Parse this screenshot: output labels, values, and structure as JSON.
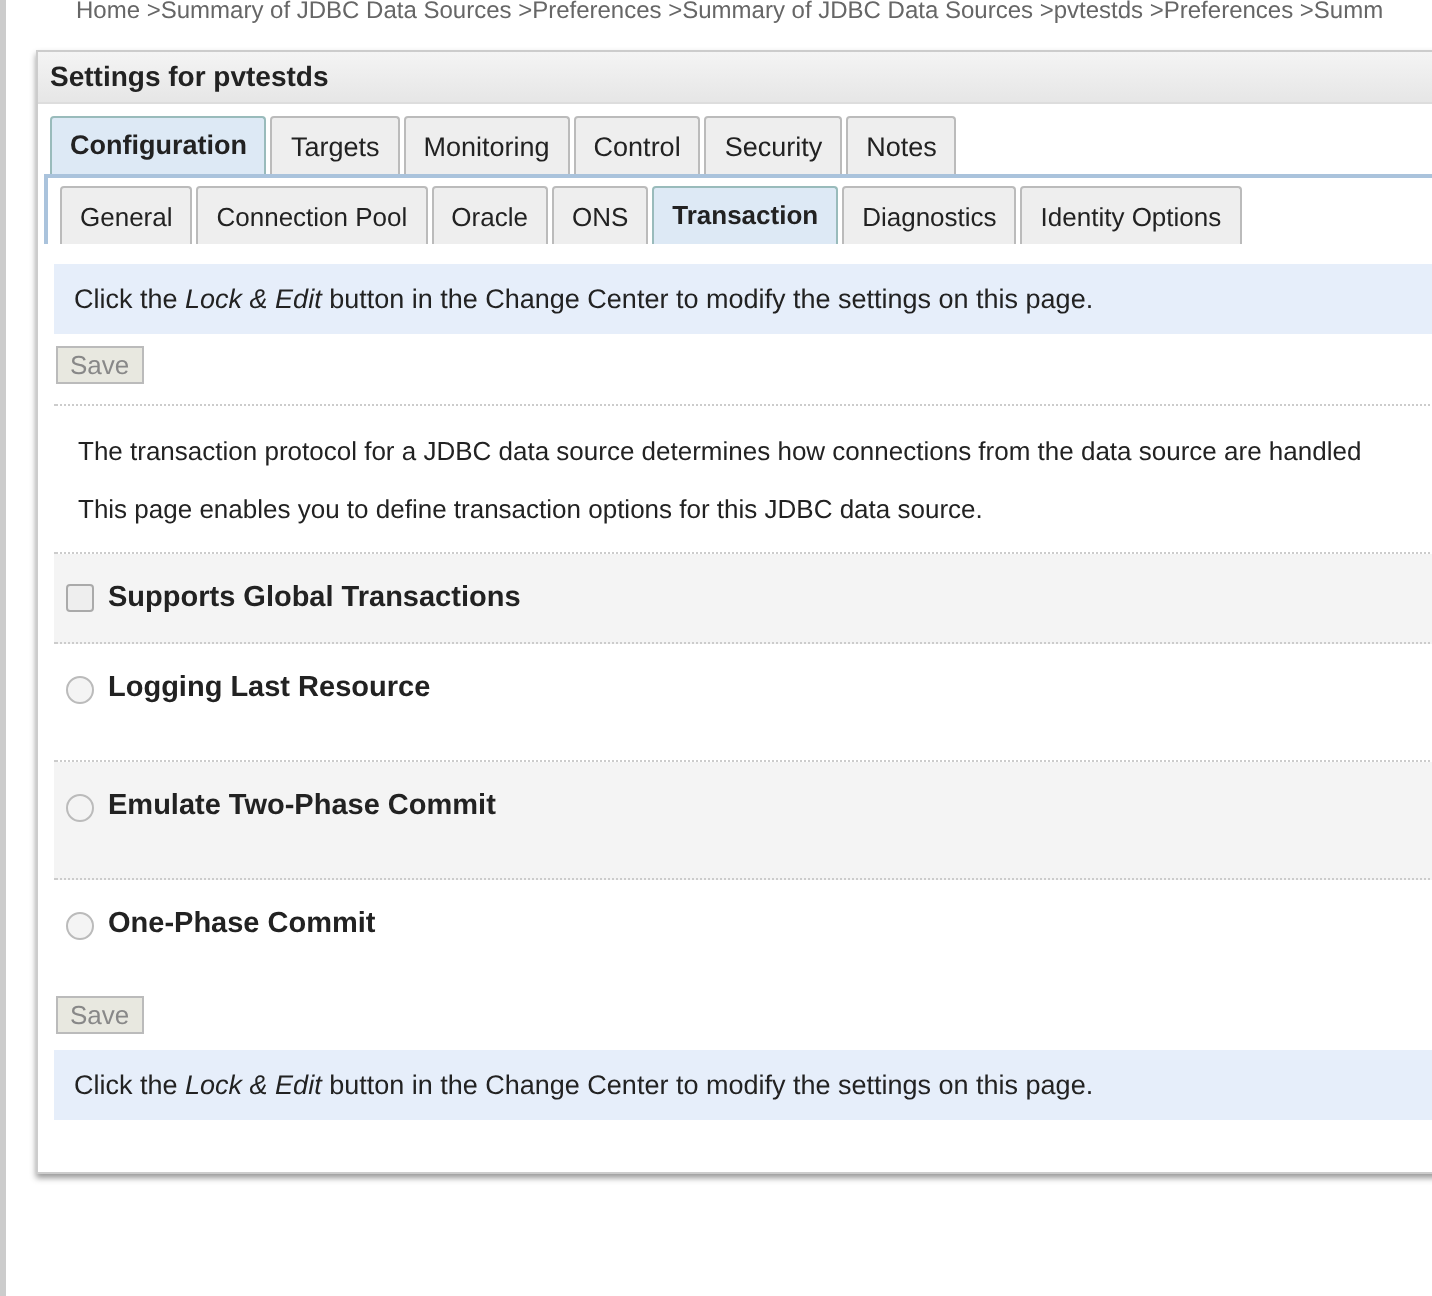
{
  "breadcrumb": "Home >Summary of JDBC Data Sources >Preferences >Summary of JDBC Data Sources >pvtestds >Preferences >Summ",
  "panel": {
    "title": "Settings for pvtestds",
    "tabs": [
      {
        "label": "Configuration",
        "selected": true
      },
      {
        "label": "Targets",
        "selected": false
      },
      {
        "label": "Monitoring",
        "selected": false
      },
      {
        "label": "Control",
        "selected": false
      },
      {
        "label": "Security",
        "selected": false
      },
      {
        "label": "Notes",
        "selected": false
      }
    ],
    "subtabs": [
      {
        "label": "General",
        "selected": false
      },
      {
        "label": "Connection Pool",
        "selected": false
      },
      {
        "label": "Oracle",
        "selected": false
      },
      {
        "label": "ONS",
        "selected": false
      },
      {
        "label": "Transaction",
        "selected": true
      },
      {
        "label": "Diagnostics",
        "selected": false
      },
      {
        "label": "Identity Options",
        "selected": false
      }
    ],
    "notice_top": "Click the *Lock & Edit* button in the Change Center to modify the settings on this page.",
    "save_top": {
      "label": "Save",
      "disabled": true
    },
    "description": [
      "The transaction protocol for a JDBC data source determines how connections from the data source are handled",
      "This page enables you to define transaction options for this JDBC data source."
    ],
    "options": [
      {
        "kind": "checkbox",
        "label": "Supports Global Transactions",
        "checked": false,
        "disabled": true
      },
      {
        "kind": "radio",
        "label": "Logging Last Resource",
        "selected": false
      },
      {
        "kind": "radio",
        "label": "Emulate Two-Phase Commit",
        "selected": false
      },
      {
        "kind": "radio",
        "label": "One-Phase Commit",
        "selected": false
      }
    ],
    "save_bottom": {
      "label": "Save",
      "disabled": true
    },
    "notice_bottom": "Click the *Lock & Edit* button in the Change Center to modify the settings on this page."
  }
}
